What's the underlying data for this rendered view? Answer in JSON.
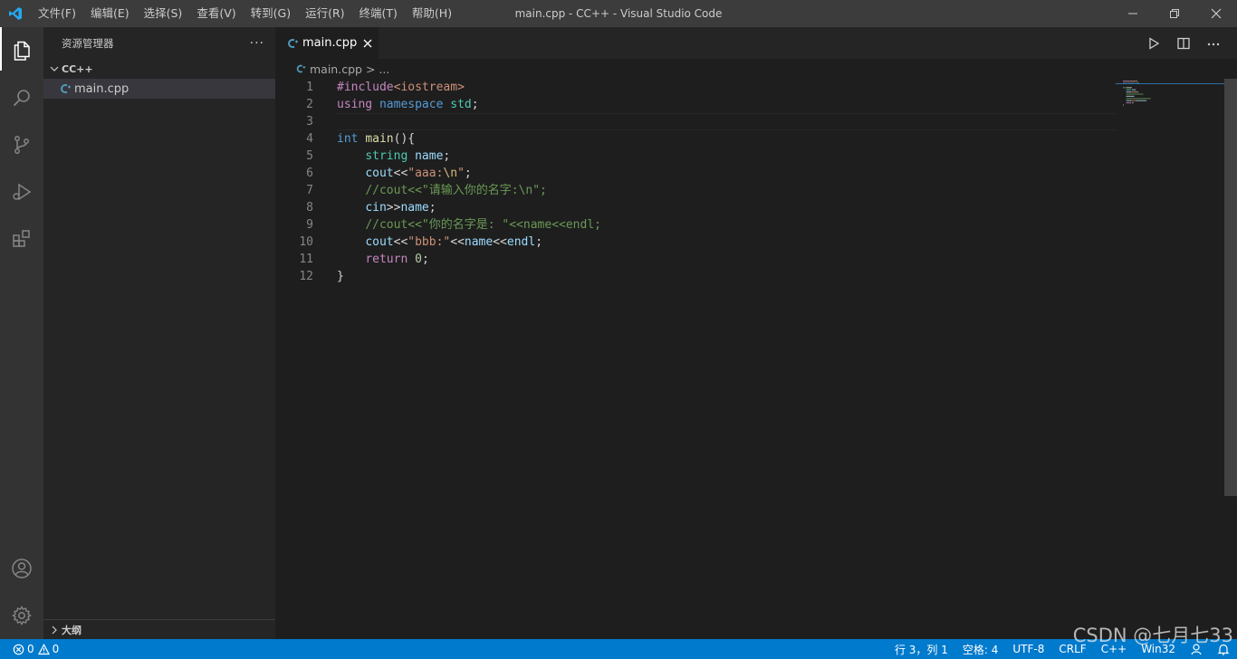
{
  "titlebar": {
    "menu": [
      "文件(F)",
      "编辑(E)",
      "选择(S)",
      "查看(V)",
      "转到(G)",
      "运行(R)",
      "终端(T)",
      "帮助(H)"
    ],
    "title": "main.cpp - CC++ - Visual Studio Code"
  },
  "sidebar": {
    "title": "资源管理器",
    "more": "···",
    "folder": "CC++",
    "file": "main.cpp",
    "outline": "大纲"
  },
  "editor": {
    "tab_label": "main.cpp",
    "breadcrumb_file": "main.cpp",
    "breadcrumb_sep": ">",
    "breadcrumb_more": "...",
    "line_numbers": [
      "1",
      "2",
      "3",
      "4",
      "5",
      "6",
      "7",
      "8",
      "9",
      "10",
      "11",
      "12"
    ],
    "cursor_line": 3
  },
  "code": [
    [
      {
        "t": "#include",
        "c": "pp"
      },
      {
        "t": "<iostream>",
        "c": "str"
      }
    ],
    [
      {
        "t": "using",
        "c": "pp"
      },
      {
        "t": " ",
        "c": "plain"
      },
      {
        "t": "namespace",
        "c": "blue"
      },
      {
        "t": " ",
        "c": "plain"
      },
      {
        "t": "std",
        "c": "type"
      },
      {
        "t": ";",
        "c": "plain"
      }
    ],
    [],
    [
      {
        "t": "int",
        "c": "blue"
      },
      {
        "t": " ",
        "c": "plain"
      },
      {
        "t": "main",
        "c": "fn"
      },
      {
        "t": "(){",
        "c": "plain"
      }
    ],
    [
      {
        "t": "    ",
        "c": "plain"
      },
      {
        "t": "string",
        "c": "type"
      },
      {
        "t": " ",
        "c": "plain"
      },
      {
        "t": "name",
        "c": "var"
      },
      {
        "t": ";",
        "c": "plain"
      }
    ],
    [
      {
        "t": "    ",
        "c": "plain"
      },
      {
        "t": "cout",
        "c": "var"
      },
      {
        "t": "<<",
        "c": "plain"
      },
      {
        "t": "\"aaa:",
        "c": "str"
      },
      {
        "t": "\\n",
        "c": "esc"
      },
      {
        "t": "\"",
        "c": "str"
      },
      {
        "t": ";",
        "c": "plain"
      }
    ],
    [
      {
        "t": "    ",
        "c": "plain"
      },
      {
        "t": "//cout<<\"请输入你的名字:\\n\";",
        "c": "cmt"
      }
    ],
    [
      {
        "t": "    ",
        "c": "plain"
      },
      {
        "t": "cin",
        "c": "var"
      },
      {
        "t": ">>",
        "c": "plain"
      },
      {
        "t": "name",
        "c": "var"
      },
      {
        "t": ";",
        "c": "plain"
      }
    ],
    [
      {
        "t": "    ",
        "c": "plain"
      },
      {
        "t": "//cout<<\"你的名字是: \"<<name<<endl;",
        "c": "cmt"
      }
    ],
    [
      {
        "t": "    ",
        "c": "plain"
      },
      {
        "t": "cout",
        "c": "var"
      },
      {
        "t": "<<",
        "c": "plain"
      },
      {
        "t": "\"bbb:\"",
        "c": "str"
      },
      {
        "t": "<<",
        "c": "plain"
      },
      {
        "t": "name",
        "c": "var"
      },
      {
        "t": "<<",
        "c": "plain"
      },
      {
        "t": "endl",
        "c": "var"
      },
      {
        "t": ";",
        "c": "plain"
      }
    ],
    [
      {
        "t": "    ",
        "c": "plain"
      },
      {
        "t": "return",
        "c": "pp"
      },
      {
        "t": " ",
        "c": "plain"
      },
      {
        "t": "0",
        "c": "num"
      },
      {
        "t": ";",
        "c": "plain"
      }
    ],
    [
      {
        "t": "}",
        "c": "plain"
      }
    ]
  ],
  "statusbar": {
    "errors": "0",
    "warnings": "0",
    "position": "行 3，列 1",
    "spaces": "空格: 4",
    "encoding": "UTF-8",
    "eol": "CRLF",
    "language": "C++",
    "platform": "Win32"
  },
  "watermark": "CSDN @七月七33",
  "colors": {
    "accent": "#007acc",
    "titlebar": "#3c3c3c",
    "activitybar": "#333333",
    "sidebar": "#252526",
    "editor": "#1e1e1e",
    "vscode_logo": "#23a9f2",
    "cpp_icon": "#519aba"
  },
  "icons": {
    "activity": [
      "explorer-icon",
      "search-icon",
      "source-control-icon",
      "run-debug-icon",
      "extensions-icon"
    ],
    "activity_bottom": [
      "account-icon",
      "settings-gear-icon"
    ]
  }
}
